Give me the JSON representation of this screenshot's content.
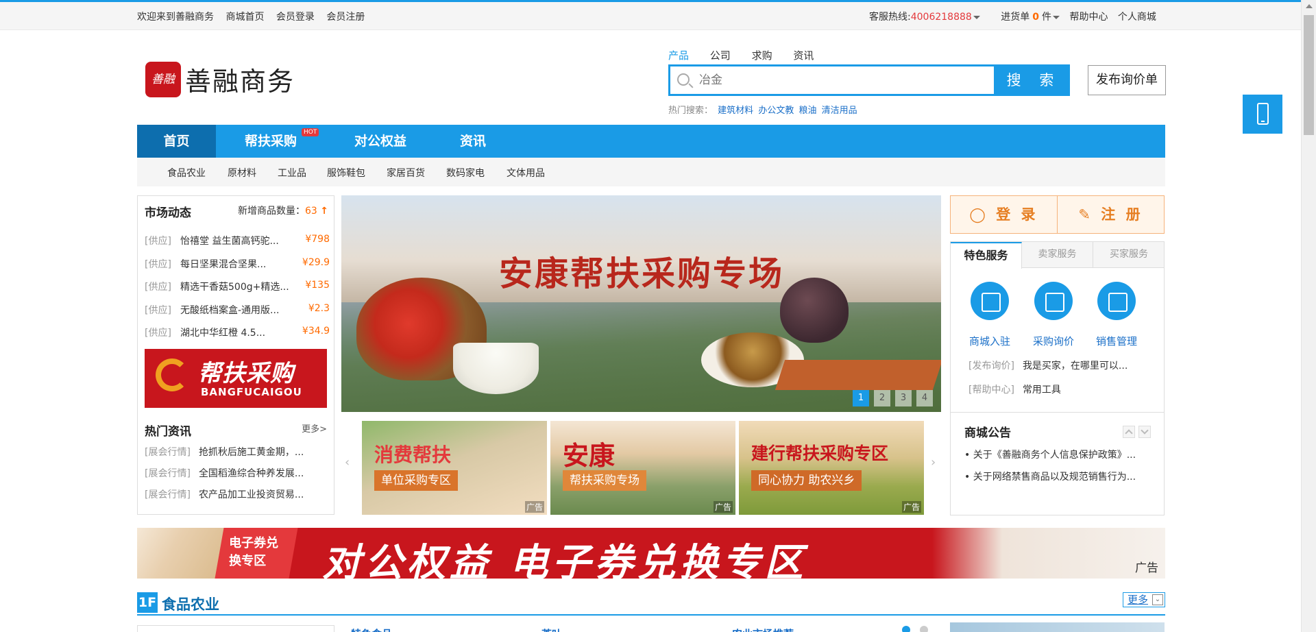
{
  "topbar": {
    "welcome": "欢迎来到善融商务",
    "links": [
      "商城首页",
      "会员登录",
      "会员注册"
    ],
    "hotline_label": "客服热线:",
    "hotline_number": "4006218888",
    "cart_label": "进货单",
    "cart_count": "0",
    "cart_unit": "件",
    "help": "帮助中心",
    "personal_mall": "个人商城"
  },
  "logo": {
    "mark": "善融",
    "text": "善融商务"
  },
  "search": {
    "tabs": [
      "产品",
      "公司",
      "求购",
      "资讯"
    ],
    "active_tab": "产品",
    "placeholder": "冶金",
    "button": "搜 索",
    "hot_label": "热门搜索：",
    "hot_keywords": [
      "建筑材料",
      "办公文教",
      "粮油",
      "清洁用品"
    ]
  },
  "rfq_button": "发布询价单",
  "nav": {
    "items": [
      "首页",
      "帮扶采购",
      "对公权益",
      "资讯"
    ],
    "hot_badge": "HOT",
    "sub_items": [
      "食品农业",
      "原材料",
      "工业品",
      "服饰鞋包",
      "家居百货",
      "数码家电",
      "文体用品"
    ]
  },
  "market": {
    "title": "市场动态",
    "new_count_label": "新增商品数量：",
    "new_count": "63",
    "rows": [
      {
        "tag": "[供应]",
        "name": "怡禧堂 益生菌高钙驼...",
        "price": "¥798"
      },
      {
        "tag": "[供应]",
        "name": "每日坚果混合坚果...",
        "price": "¥29.9"
      },
      {
        "tag": "[供应]",
        "name": "精选干香菇500g+精选...",
        "price": "¥135"
      },
      {
        "tag": "[供应]",
        "name": "无酸纸档案盒-通用版...",
        "price": "¥2.3"
      },
      {
        "tag": "[供应]",
        "name": "湖北中华红橙 4.5...",
        "price": "¥34.9"
      }
    ],
    "banner_cn": "帮扶采购",
    "banner_en": "BANGFUCAIGOU"
  },
  "hot_news": {
    "title": "热门资讯",
    "more": "更多>",
    "rows": [
      {
        "tag": "[展会行情]",
        "title": "抢抓秋后施工黄金期，..."
      },
      {
        "tag": "[展会行情]",
        "title": "全国稻渔综合种养发展..."
      },
      {
        "tag": "[展会行情]",
        "title": "农产品加工业投资贸易..."
      }
    ]
  },
  "banner": {
    "title": "安康帮扶采购专场",
    "dots": [
      "1",
      "2",
      "3",
      "4"
    ],
    "active_dot": "1"
  },
  "ads": [
    {
      "main": "消费帮扶",
      "sub": "单位采购专区",
      "label": "广告",
      "color": "#e4393c",
      "sub_bg": "#d9742b"
    },
    {
      "main": "安康",
      "sub": "帮扶采购专场",
      "label": "广告",
      "color": "#c8161d",
      "sub_bg": "#e0873a"
    },
    {
      "main": "建行帮扶采购专区",
      "sub": "同心协力 助农兴乡",
      "label": "广告",
      "color": "#c8161d",
      "sub_bg": "#cf6a28"
    }
  ],
  "auth": {
    "login": "登 录",
    "register": "注 册"
  },
  "services": {
    "tabs": [
      "特色服务",
      "卖家服务",
      "买家服务"
    ],
    "active_tab": "特色服务",
    "icons": [
      "商城入驻",
      "采购询价",
      "销售管理"
    ],
    "rows": [
      {
        "tag": "[发布询价]",
        "text": "我是买家，在哪里可以..."
      },
      {
        "tag": "[帮助中心]",
        "text": "常用工具"
      }
    ]
  },
  "notice": {
    "title": "商城公告",
    "rows": [
      "关于《善融商务个人信息保护政策》...",
      "关于网络禁售商品以及规范销售行为..."
    ]
  },
  "wide_banner": {
    "tag": "电子券兑换专区",
    "title": "对公权益 电子券兑换专区",
    "label": "广告"
  },
  "floor": {
    "num": "1F",
    "name": "食品农业",
    "more": "更多",
    "sub_titles": [
      "特色食品",
      "茶叶",
      "农业市场推荐"
    ]
  }
}
